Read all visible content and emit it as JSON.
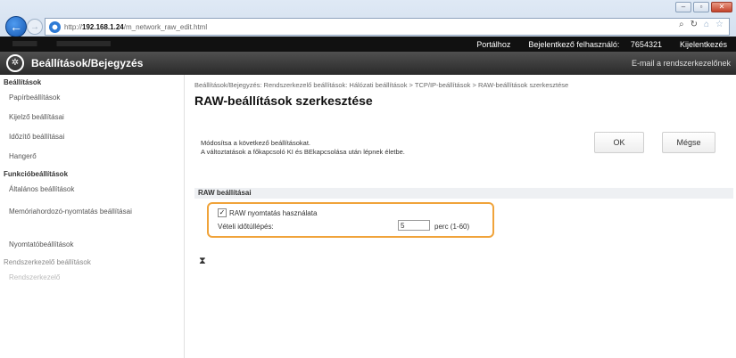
{
  "browser": {
    "url_prefix": "http://",
    "url_host": "192.168.1.24",
    "url_path": "/m_network_raw_edit.html",
    "search_icon": "search-icon",
    "refresh_icon": "refresh-icon"
  },
  "topbar": {
    "portal": "Portálhoz",
    "logged_in_user": "Bejelentkező felhasználó:",
    "user_id": "7654321",
    "logout": "Kijelentkezés"
  },
  "app": {
    "title": "Beállítások/Bejegyzés",
    "email_admin": "E-mail a rendszerkezelőnek"
  },
  "sidebar": {
    "sections": [
      {
        "heading": "Beállítások",
        "items": [
          "Papírbeállítások",
          "Kijelző beállításai",
          "Időzítő beállításai",
          "Hangerő"
        ]
      },
      {
        "heading": "Funkcióbeállítások",
        "items": [
          "Általános beállítások",
          "Memóriahordozó-nyomtatás beállításai",
          "Nyomtatóbeállítások"
        ]
      }
    ],
    "dim_heading": "Rendszerkezelő beállítások",
    "faded_item": "Rendszerkezelő"
  },
  "main": {
    "breadcrumb": "Beállítások/Bejegyzés: Rendszerkezelő beállítások: Hálózati beállítások > TCP/IP-beállítások > RAW-beállítások szerkesztése",
    "title": "RAW-beállítások szerkesztése",
    "desc_line1": "Módosítsa a következő beállításokat.",
    "desc_line2": "A változtatások a főkapcsoló KI és BEkapcsolása után lépnek életbe.",
    "ok_label": "OK",
    "cancel_label": "Mégse",
    "section_heading": "RAW beállításai",
    "use_raw_label": "RAW nyomtatás használata",
    "use_raw_checked": true,
    "timeout_label": "Vételi időtúllépés:",
    "timeout_value": "5",
    "timeout_unit": "perc (1-60)"
  }
}
